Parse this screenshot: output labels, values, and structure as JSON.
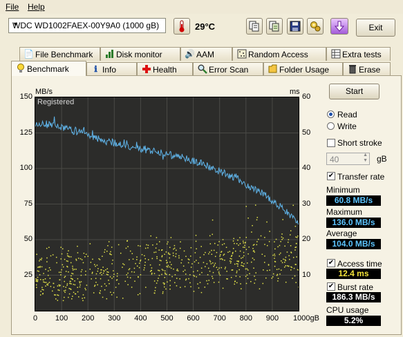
{
  "menu": {
    "file": "File",
    "help": "Help"
  },
  "toolbar": {
    "drive": "WDC WD1002FAEX-00Y9A0 (1000 gB)",
    "temperature": "29°C",
    "exit": "Exit",
    "icons": [
      "thermometer-icon",
      "copy-text-icon",
      "copy-info-icon",
      "save-icon",
      "options-icon",
      "download-icon"
    ]
  },
  "tabs_top": [
    {
      "label": "File Benchmark",
      "icon": "file-benchmark-icon"
    },
    {
      "label": "Disk monitor",
      "icon": "disk-monitor-icon"
    },
    {
      "label": "AAM",
      "icon": "speaker-icon"
    },
    {
      "label": "Random Access",
      "icon": "random-access-icon"
    },
    {
      "label": "Extra tests",
      "icon": "extra-tests-icon"
    }
  ],
  "tabs_bottom": [
    {
      "label": "Benchmark",
      "icon": "bulb-icon"
    },
    {
      "label": "Info",
      "icon": "info-icon"
    },
    {
      "label": "Health",
      "icon": "health-cross-icon"
    },
    {
      "label": "Error Scan",
      "icon": "magnifier-icon"
    },
    {
      "label": "Folder Usage",
      "icon": "folder-icon"
    },
    {
      "label": "Erase",
      "icon": "trash-icon"
    }
  ],
  "benchmark": {
    "start": "Start",
    "read": "Read",
    "write": "Write",
    "read_selected": true,
    "short_stroke": "Short stroke",
    "short_stroke_checked": false,
    "stroke_value": "40",
    "stroke_unit": "gB",
    "transfer_rate": "Transfer rate",
    "transfer_rate_checked": true,
    "minimum_label": "Minimum",
    "minimum": "60.8 MB/s",
    "maximum_label": "Maximum",
    "maximum": "136.0 MB/s",
    "average_label": "Average",
    "average": "104.0 MB/s",
    "access_time": "Access time",
    "access_time_checked": true,
    "access_value": "12.4 ms",
    "burst_rate": "Burst rate",
    "burst_rate_checked": true,
    "burst_value": "186.3 MB/s",
    "cpu_label": "CPU usage",
    "cpu_value": "5.2%",
    "watermark": "Registered"
  },
  "chart_data": {
    "type": "line",
    "y_left_label": "MB/s",
    "y_right_label": "ms",
    "x_unit": "gB",
    "ylim": [
      0,
      150
    ],
    "y2lim": [
      0,
      60
    ],
    "xlim": [
      0,
      1000
    ],
    "y_ticks": [
      "150",
      "125",
      "100",
      "75",
      "50",
      "25"
    ],
    "y2_ticks": [
      "60",
      "50",
      "40",
      "30",
      "20",
      "10"
    ],
    "x_ticks": [
      "0",
      "100",
      "200",
      "300",
      "400",
      "500",
      "600",
      "700",
      "800",
      "900",
      "1000gB"
    ],
    "grid": true,
    "series": [
      {
        "name": "Transfer rate",
        "color": "#5fb3e8",
        "x": [
          0,
          25,
          50,
          75,
          100,
          125,
          150,
          175,
          200,
          225,
          250,
          275,
          300,
          325,
          350,
          375,
          400,
          425,
          450,
          475,
          500,
          525,
          550,
          575,
          600,
          625,
          650,
          675,
          700,
          725,
          750,
          775,
          800,
          825,
          850,
          875,
          900,
          925,
          950,
          975,
          1000
        ],
        "values": [
          132,
          132,
          131,
          131,
          129,
          128,
          126,
          126,
          124,
          122,
          120,
          119,
          118,
          117,
          116,
          115,
          114,
          113,
          112,
          111,
          110,
          109,
          108,
          107,
          105,
          104,
          102,
          100,
          98,
          96,
          94,
          92,
          89,
          86,
          84,
          81,
          77,
          74,
          70,
          66,
          62
        ]
      },
      {
        "name": "Access time",
        "color": "#e6e64a",
        "kind": "scatter",
        "trend_x": [
          0,
          200,
          400,
          600,
          800,
          1000
        ],
        "trend_ms": [
          9.5,
          11,
          12.5,
          13.5,
          14.5,
          15.5
        ]
      }
    ]
  }
}
